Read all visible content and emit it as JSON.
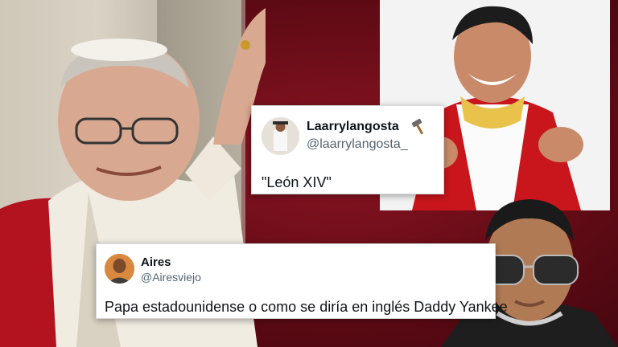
{
  "tweets": [
    {
      "display_name": "Laarrylangosta",
      "name_emoji": "hammer-icon",
      "handle": "@laarrylangosta_",
      "text": "\"León XIV\""
    },
    {
      "display_name": "Aires",
      "handle": "@Airesviejo",
      "text": "Papa estadounidense o como se diría en inglés Daddy Yankee"
    }
  ],
  "colors": {
    "background": "#6e0f1b",
    "card": "#ffffff",
    "handle_text": "#536471"
  }
}
